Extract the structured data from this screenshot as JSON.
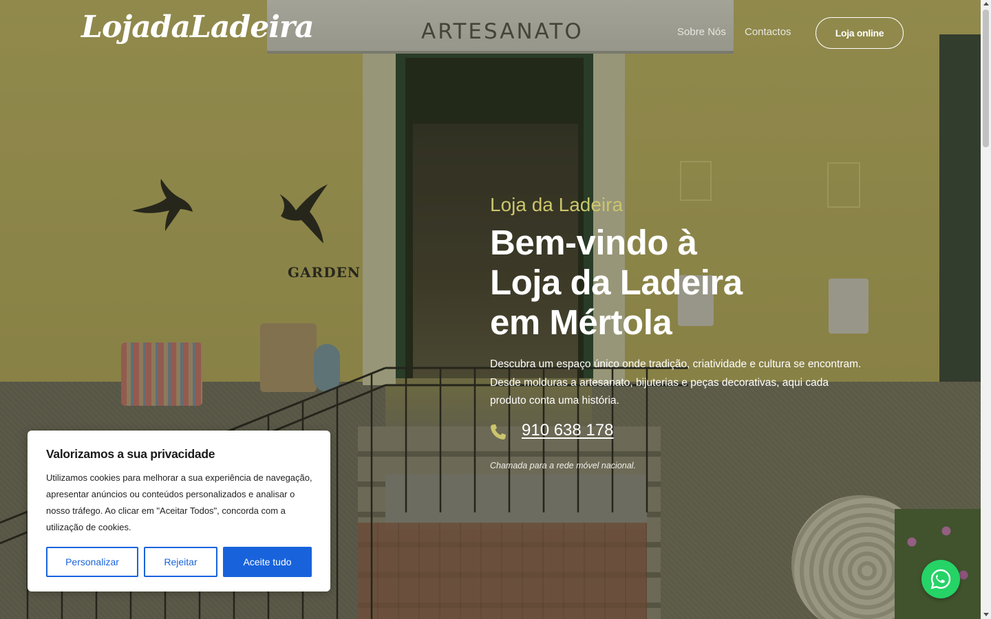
{
  "header": {
    "logo_text": "LojadaLadeira",
    "nav": [
      {
        "label": "Sobre Nós"
      },
      {
        "label": "Contactos"
      }
    ],
    "shop_button": "Loja online"
  },
  "background": {
    "awning_text": "ARTESANATO",
    "sign_text": "GARDEN"
  },
  "hero": {
    "kicker": "Loja da Ladeira",
    "title_lines": [
      "Bem-vindo à",
      "Loja da Ladeira",
      "em Mértola"
    ],
    "description": "Descubra um espaço único onde tradição, criatividade e cultura se encontram. Desde molduras a artesanato, bijuterias e peças decorativas, aqui cada produto conta uma história.",
    "phone": "910 638 178",
    "phone_note": "Chamada para a rede móvel nacional.",
    "phone_icon": "phone-icon"
  },
  "cookie_banner": {
    "title": "Valorizamos a sua privacidade",
    "text": "Utilizamos cookies para melhorar a sua experiência de navegação, apresentar anúncios ou conteúdos personalizados e analisar o nosso tráfego. Ao clicar em \"Aceitar Todos\", concorda com a utilização de cookies.",
    "buttons": {
      "customize": "Personalizar",
      "reject": "Rejeitar",
      "accept": "Aceite tudo"
    }
  },
  "floating": {
    "whatsapp_icon": "whatsapp-icon"
  },
  "colors": {
    "accent_kicker": "#cbc56c",
    "cookie_primary": "#1863dc",
    "whatsapp": "#25d366"
  }
}
